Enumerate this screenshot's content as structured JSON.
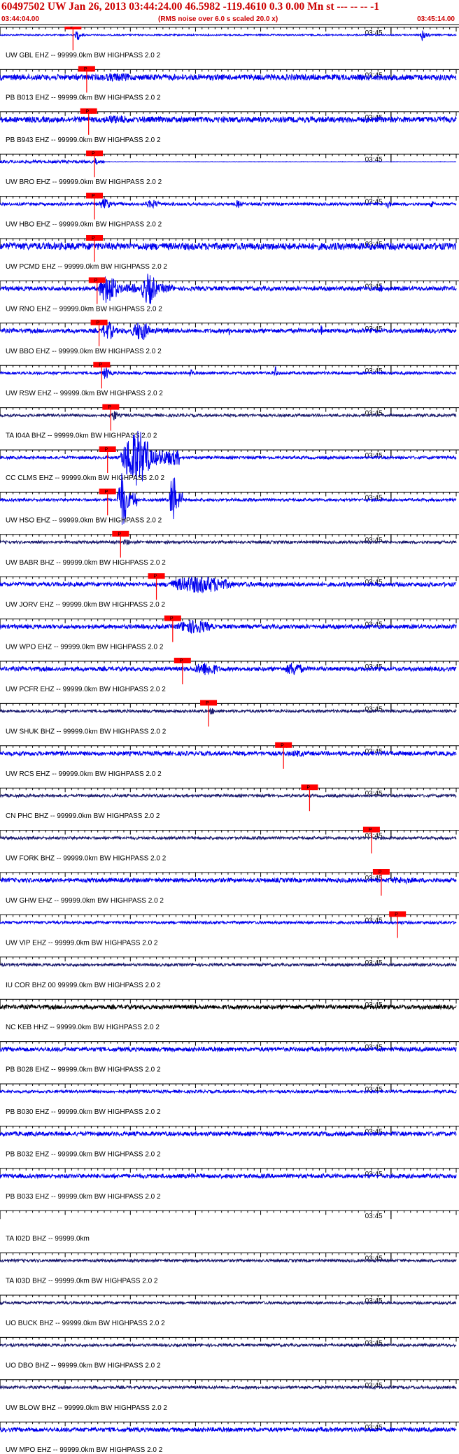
{
  "header": {
    "title": "60497502 UW Jan 26, 2013 03:44:24.00   46.5982 -119.4610  0.3 0.00 Mn st --- -- --  -1",
    "start_time": "03:44:04.00",
    "note": "(RMS noise over 6.0 s scaled 20.0 x)",
    "end_time": "03:45:14.00"
  },
  "colors": {
    "text_red": "#cc0000",
    "trace_blue": "#0000ee",
    "trace_navy": "#1a1a6e",
    "trace_black": "#000000",
    "pick_red": "#ff0000"
  },
  "chart_data": {
    "type": "seismogram",
    "time_range": [
      "03:44:04.00",
      "03:45:14.00"
    ],
    "tick_label": "03:45",
    "tick_label_time_s": 56,
    "minute_marks_s": [
      0,
      60
    ],
    "duration_s": 70,
    "pick_label": "P",
    "traces": [
      {
        "label": "UW GBL EHZ -- 99999.0km BW HIGHPASS 2.0 2",
        "color": "blue",
        "amp": 1,
        "pick_s": 11.2,
        "events": [
          {
            "t": 11.5,
            "dur": 1.5,
            "a": 8
          },
          {
            "t": 64.5,
            "dur": 1.5,
            "a": 10
          }
        ]
      },
      {
        "label": "PB B013 EHZ -- 99999.0km BW HIGHPASS 2.0 2",
        "color": "blue",
        "amp": 4,
        "pick_s": 13.3,
        "events": [
          {
            "t": 13.5,
            "dur": 16,
            "a": 6
          }
        ]
      },
      {
        "label": "PB B943 EHZ -- 99999.0km BW HIGHPASS 2.0 2",
        "color": "blue",
        "amp": 4,
        "pick_s": 13.6,
        "events": [
          {
            "t": 14,
            "dur": 14,
            "a": 6
          }
        ]
      },
      {
        "label": "UW BRO EHZ -- 99999.0km BW HIGHPASS 2.0 2",
        "color": "blue",
        "amp": 2,
        "pick_s": 14.5,
        "events": [
          {
            "t": 14.6,
            "dur": 0.6,
            "a": 8
          }
        ],
        "flat_after_s": 16
      },
      {
        "label": "UW HBO EHZ -- 99999.0km BW HIGHPASS 2.0 2",
        "color": "blue",
        "amp": 2,
        "pick_s": 14.5,
        "events": [
          {
            "t": 15,
            "dur": 4,
            "a": 8
          },
          {
            "t": 22,
            "dur": 5,
            "a": 6
          },
          {
            "t": 36,
            "dur": 2,
            "a": 6
          },
          {
            "t": 59,
            "dur": 2,
            "a": 6
          },
          {
            "t": 66,
            "dur": 1,
            "a": 6
          }
        ]
      },
      {
        "label": "UW PCMD EHZ -- 99999.0km BW HIGHPASS 2.0 2",
        "color": "blue",
        "amp": 5,
        "pick_s": 14.5,
        "events": [
          {
            "t": 15,
            "dur": 50,
            "a": 3
          },
          {
            "t": 34,
            "dur": 15,
            "a": 4
          }
        ]
      },
      {
        "label": "UW RNO EHZ -- 99999.0km BW HIGHPASS 2.0 2",
        "color": "blue",
        "amp": 3,
        "pick_s": 14.9,
        "events": [
          {
            "t": 15,
            "dur": 6,
            "a": 22
          },
          {
            "t": 21.5,
            "dur": 5,
            "a": 22
          },
          {
            "t": 58,
            "dur": 1.5,
            "a": 6
          }
        ]
      },
      {
        "label": "UW BBO EHZ -- 99999.0km BW HIGHPASS 2.0 2",
        "color": "blue",
        "amp": 3,
        "pick_s": 15.2,
        "events": [
          {
            "t": 15.5,
            "dur": 4,
            "a": 14
          },
          {
            "t": 20,
            "dur": 6,
            "a": 14
          },
          {
            "t": 35,
            "dur": 1,
            "a": 8
          },
          {
            "t": 49,
            "dur": 1,
            "a": 8
          }
        ]
      },
      {
        "label": "UW RSW EHZ -- 99999.0km BW HIGHPASS 2.0 2",
        "color": "blue",
        "amp": 2,
        "pick_s": 15.6,
        "events": [
          {
            "t": 15.7,
            "dur": 2,
            "a": 10
          },
          {
            "t": 29,
            "dur": 1,
            "a": 8
          },
          {
            "t": 42,
            "dur": 1,
            "a": 10
          }
        ]
      },
      {
        "label": "TA I04A BHZ -- 99999.0km BW HIGHPASS 2.0 2",
        "color": "navy",
        "amp": 2,
        "pick_s": 17,
        "events": [
          {
            "t": 17,
            "dur": 2,
            "a": 8
          }
        ]
      },
      {
        "label": "CC CLMS EHZ -- 99999.0km BW HIGHPASS 2.0 2",
        "color": "blue",
        "amp": 2,
        "pick_s": 16.5,
        "events": [
          {
            "t": 18.5,
            "dur": 9,
            "a": 40
          }
        ]
      },
      {
        "label": "UW HSO EHZ -- 99999.0km BW HIGHPASS 2.0 2",
        "color": "blue",
        "amp": 2,
        "pick_s": 16.5,
        "events": [
          {
            "t": 18,
            "dur": 3,
            "a": 40
          },
          {
            "t": 26,
            "dur": 2,
            "a": 40
          }
        ]
      },
      {
        "label": "UW BABR BHZ -- 99999.0km BW HIGHPASS 2.0 2",
        "color": "navy",
        "amp": 2,
        "pick_s": 18.5,
        "events": [
          {
            "t": 18.6,
            "dur": 3,
            "a": 4
          }
        ]
      },
      {
        "label": "UW JORV EHZ -- 99999.0km BW HIGHPASS 2.0 2",
        "color": "blue",
        "amp": 3,
        "pick_s": 24,
        "events": [
          {
            "t": 25,
            "dur": 21,
            "a": 12
          }
        ]
      },
      {
        "label": "UW WPO EHZ -- 99999.0km BW HIGHPASS 2.0 2",
        "color": "blue",
        "amp": 3,
        "pick_s": 26.5,
        "events": [
          {
            "t": 26.5,
            "dur": 12,
            "a": 10
          }
        ]
      },
      {
        "label": "UW PCFR EHZ -- 99999.0km BW HIGHPASS 2.0 2",
        "color": "blue",
        "amp": 3,
        "pick_s": 28,
        "events": [
          {
            "t": 29.5,
            "dur": 8,
            "a": 10
          },
          {
            "t": 43.5,
            "dur": 6,
            "a": 10
          }
        ]
      },
      {
        "label": "UW SHUK BHZ -- 99999.0km BW HIGHPASS 2.0 2",
        "color": "navy",
        "amp": 2,
        "pick_s": 32,
        "events": [
          {
            "t": 32,
            "dur": 2,
            "a": 5
          }
        ]
      },
      {
        "label": "UW RCS EHZ -- 99999.0km BW HIGHPASS 2.0 2",
        "color": "blue",
        "amp": 3,
        "pick_s": 43.5,
        "events": [
          {
            "t": 44,
            "dur": 6,
            "a": 5
          }
        ]
      },
      {
        "label": "CN PHC BHZ -- 99999.0km BW HIGHPASS 2.0 2",
        "color": "navy",
        "amp": 2,
        "pick_s": 47.5,
        "events": []
      },
      {
        "label": "UW FORK BHZ -- 99999.0km BW HIGHPASS 2.0 2",
        "color": "navy",
        "amp": 2,
        "pick_s": 57,
        "events": []
      },
      {
        "label": "UW GHW EHZ -- 99999.0km BW HIGHPASS 2.0 2",
        "color": "blue",
        "amp": 3,
        "pick_s": 58.5,
        "events": [
          {
            "t": 58.5,
            "dur": 11,
            "a": 5
          }
        ]
      },
      {
        "label": "UW VIP EHZ -- 99999.0km BW HIGHPASS 2.0 2",
        "color": "blue",
        "amp": 2,
        "pick_s": 61,
        "events": [
          {
            "t": 61,
            "dur": 2,
            "a": 3
          }
        ]
      },
      {
        "label": "IU COR BHZ 00 99999.0km BW HIGHPASS 2.0 2",
        "color": "navy",
        "amp": 2,
        "events": []
      },
      {
        "label": "NC KEB HHZ -- 99999.0km BW HIGHPASS 2.0 2",
        "color": "black",
        "amp": 3,
        "events": []
      },
      {
        "label": "PB B028 EHZ -- 99999.0km BW HIGHPASS 2.0 2",
        "color": "blue",
        "amp": 3,
        "events": []
      },
      {
        "label": "PB B030 EHZ -- 99999.0km BW HIGHPASS 2.0 2",
        "color": "blue",
        "amp": 2,
        "events": []
      },
      {
        "label": "PB B032 EHZ -- 99999.0km BW HIGHPASS 2.0 2",
        "color": "blue",
        "amp": 3,
        "events": []
      },
      {
        "label": "PB B033 EHZ -- 99999.0km BW HIGHPASS 2.0 2",
        "color": "blue",
        "amp": 3,
        "events": []
      },
      {
        "label": "TA I02D BHZ -- 99999.0km",
        "color": "none",
        "amp": 0,
        "events": []
      },
      {
        "label": "TA I03D BHZ -- 99999.0km BW HIGHPASS 2.0 2",
        "color": "navy",
        "amp": 2,
        "events": []
      },
      {
        "label": "UO BUCK BHZ -- 99999.0km BW HIGHPASS 2.0 2",
        "color": "navy",
        "amp": 2,
        "events": []
      },
      {
        "label": "UO DBO BHZ -- 99999.0km BW HIGHPASS 2.0 2",
        "color": "navy",
        "amp": 2,
        "events": [
          {
            "t": 61,
            "dur": 3,
            "a": 2
          }
        ]
      },
      {
        "label": "UW BLOW BHZ -- 99999.0km BW HIGHPASS 2.0 2",
        "color": "navy",
        "amp": 2,
        "events": []
      },
      {
        "label": "UW MPO EHZ -- 99999.0km BW HIGHPASS 2.0 2",
        "color": "blue",
        "amp": 3,
        "events": []
      }
    ]
  }
}
